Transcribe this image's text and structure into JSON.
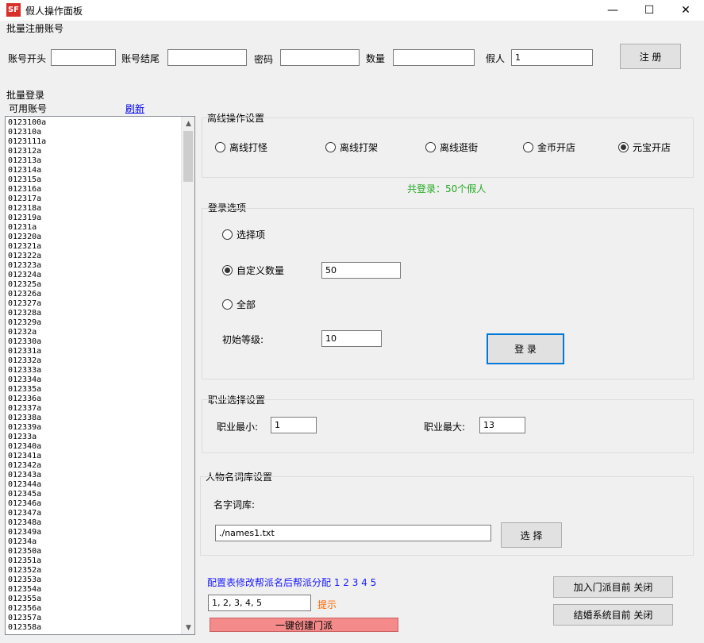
{
  "window": {
    "app_icon_text": "SF",
    "title": "假人操作面板",
    "minimize_glyph": "—",
    "maximize_glyph": "☐",
    "close_glyph": "✕"
  },
  "register": {
    "section_label": "批量注册账号",
    "prefix_label": "账号开头",
    "prefix_value": "",
    "suffix_label": "账号结尾",
    "suffix_value": "",
    "password_label": "密码",
    "password_value": "",
    "count_label": "数量",
    "count_value": "",
    "fake_label": "假人",
    "fake_value": "1",
    "register_button": "注  册"
  },
  "login_list": {
    "section_label": "批量登录",
    "available_label": "可用账号",
    "refresh_link": "刷新",
    "accounts": [
      "0123100a",
      "012310a",
      "0123111a",
      "012312a",
      "012313a",
      "012314a",
      "012315a",
      "012316a",
      "012317a",
      "012318a",
      "012319a",
      "01231a",
      "012320a",
      "012321a",
      "012322a",
      "012323a",
      "012324a",
      "012325a",
      "012326a",
      "012327a",
      "012328a",
      "012329a",
      "01232a",
      "012330a",
      "012331a",
      "012332a",
      "012333a",
      "012334a",
      "012335a",
      "012336a",
      "012337a",
      "012338a",
      "012339a",
      "01233a",
      "012340a",
      "012341a",
      "012342a",
      "012343a",
      "012344a",
      "012345a",
      "012346a",
      "012347a",
      "012348a",
      "012349a",
      "01234a",
      "012350a",
      "012351a",
      "012352a",
      "012353a",
      "012354a",
      "012355a",
      "012356a",
      "012357a",
      "012358a"
    ],
    "scroll_up_glyph": "▲",
    "scroll_down_glyph": "▼"
  },
  "offline": {
    "group_label": "离线操作设置",
    "options": [
      {
        "label": "离线打怪",
        "checked": false
      },
      {
        "label": "离线打架",
        "checked": false
      },
      {
        "label": "离线逛街",
        "checked": false
      },
      {
        "label": "金币开店",
        "checked": false
      },
      {
        "label": "元宝开店",
        "checked": true
      }
    ],
    "total_login_text": "共登录：50个假人"
  },
  "login_options": {
    "group_label": "登录选项",
    "option_select": "选择项",
    "option_custom": "自定义数量",
    "custom_value": "50",
    "option_all": "全部",
    "init_level_label": "初始等级:",
    "init_level_value": "10",
    "login_button": "登 录"
  },
  "profession": {
    "group_label": "职业选择设置",
    "min_label": "职业最小:",
    "min_value": "1",
    "max_label": "职业最大:",
    "max_value": "13"
  },
  "name_lib": {
    "group_label": "人物名词库设置",
    "lib_label": "名字词库:",
    "lib_path": "./names1.txt",
    "select_button": "选 择"
  },
  "faction": {
    "note_text": "配置表修改帮派名后帮派分配 1 2 3 4 5",
    "assign_value": "1, 2, 3, 4, 5",
    "hint_text": "提示",
    "create_button": "一键创建门派",
    "join_button": "加入门派目前 关闭",
    "marriage_button": "结婚系统目前 关闭"
  },
  "colors": {
    "green_text": "#22aa22",
    "blue_text": "#1a1aff",
    "hint_text": "#ff6600",
    "create_button_bg": "#f48a8a",
    "focus_border": "#0078d7"
  }
}
